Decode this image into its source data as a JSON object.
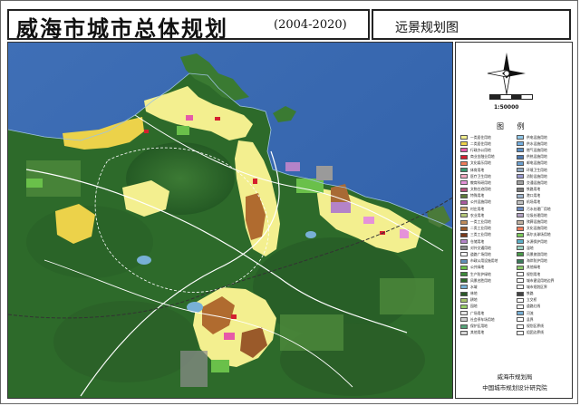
{
  "header": {
    "title": "威海市城市总体规划",
    "years": "(2004-2020)",
    "subtitle": "远景规划图"
  },
  "scale": "1:50000",
  "legend": {
    "title": "图 例",
    "left": [
      {
        "label": "一类居住用地",
        "color": "#f3ef8f"
      },
      {
        "label": "二类居住用地",
        "color": "#ecd24a"
      },
      {
        "label": "行政办公用地",
        "color": "#e65aa8"
      },
      {
        "label": "商业金融业用地",
        "color": "#d4202f"
      },
      {
        "label": "文化娱乐用地",
        "color": "#ef7b5a"
      },
      {
        "label": "体育用地",
        "color": "#3a9a6f"
      },
      {
        "label": "医疗卫生用地",
        "color": "#f2a8bf"
      },
      {
        "label": "教育科研用地",
        "color": "#e592d9"
      },
      {
        "label": "文物古迹用地",
        "color": "#b6527e"
      },
      {
        "label": "特殊用地",
        "color": "#5e7a3a"
      },
      {
        "label": "公共设施用地",
        "color": "#a95aa0"
      },
      {
        "label": "村庄用地",
        "color": "#c8a06a"
      },
      {
        "label": "农业用地",
        "color": "#b5c879"
      },
      {
        "label": "一类工业用地",
        "color": "#bf8b5a"
      },
      {
        "label": "二类工业用地",
        "color": "#9a5a2a"
      },
      {
        "label": "三类工业用地",
        "color": "#7a3a1a"
      },
      {
        "label": "仓储用地",
        "color": "#b483c8"
      },
      {
        "label": "对外交通用地",
        "color": "#8a8a8a"
      },
      {
        "label": "道路广场用地",
        "color": "#ffffff"
      },
      {
        "label": "市政公用设施用地",
        "color": "#5f8fb7"
      },
      {
        "label": "公共绿地",
        "color": "#6ac04a"
      },
      {
        "label": "生产防护绿地",
        "color": "#3d8a3a"
      },
      {
        "label": "风景名胜用地",
        "color": "#2e6a2a"
      },
      {
        "label": "水域",
        "color": "#78b0d6"
      },
      {
        "label": "林地",
        "color": "#2a5a28"
      },
      {
        "label": "耕地",
        "color": "#a8c46a"
      },
      {
        "label": "园地",
        "color": "#9ad06a"
      },
      {
        "label": "广场用地",
        "color": "#e6e6e6"
      },
      {
        "label": "社会停车场用地",
        "color": "#cfcfcf"
      },
      {
        "label": "保护区用地",
        "color": "#57a37a"
      },
      {
        "label": "其他用地",
        "color": "#d7d7d7"
      }
    ],
    "right": [
      {
        "label": "供电设施用地",
        "color": "#8fc7e8"
      },
      {
        "label": "供水设施用地",
        "color": "#73aee0"
      },
      {
        "label": "燃气设施用地",
        "color": "#5b8fc5"
      },
      {
        "label": "供热设施用地",
        "color": "#4f7ab0"
      },
      {
        "label": "邮电设施用地",
        "color": "#6aa0d0"
      },
      {
        "label": "环境卫生用地",
        "color": "#90a8c0"
      },
      {
        "label": "消防设施用地",
        "color": "#9a9ad0"
      },
      {
        "label": "交通设施用地",
        "color": "#a0a0a0"
      },
      {
        "label": "铁路用地",
        "color": "#7a7a7a"
      },
      {
        "label": "港口用地",
        "color": "#9eb4cc"
      },
      {
        "label": "机场用地",
        "color": "#c0c0c0"
      },
      {
        "label": "污水处理厂用地",
        "color": "#6a8ac0"
      },
      {
        "label": "垃圾处理用地",
        "color": "#b0a0c0"
      },
      {
        "label": "殡葬设施用地",
        "color": "#c0b0a0"
      },
      {
        "label": "文化设施用地",
        "color": "#ef7b5a"
      },
      {
        "label": "高尔夫球场用地",
        "color": "#7ac85a"
      },
      {
        "label": "水源保护用地",
        "color": "#5ab0c8"
      },
      {
        "label": "湿地",
        "color": "#9ad0c0"
      },
      {
        "label": "风景旅游用地",
        "color": "#4a9a4a"
      },
      {
        "label": "海岸防护用地",
        "color": "#3a7a5a"
      },
      {
        "label": "其他绿地",
        "color": "#8ac86a"
      },
      {
        "label": "规划用地",
        "color": "#ffffff"
      },
      {
        "label": "城市建设用地边界",
        "color": "#ffffff"
      },
      {
        "label": "城市规划区界",
        "color": "#ffffff"
      },
      {
        "label": "铁路",
        "color": "#444444"
      },
      {
        "label": "立交桥",
        "color": "#ffffff"
      },
      {
        "label": "道路红线",
        "color": "#ffffff"
      },
      {
        "label": "河流",
        "color": "#78b0d6"
      },
      {
        "label": "县界",
        "color": "#ffffff"
      },
      {
        "label": "规划区界线",
        "color": "#ffffff"
      },
      {
        "label": "组团边界线",
        "color": "#ffffff"
      }
    ]
  },
  "org": {
    "line1": "威海市规划局",
    "line2": "中国城市规划设计研究院"
  },
  "colors": {
    "sea": "#3f6fb6",
    "forest": "#2d6a2a",
    "residential": "#f3ef8f",
    "industrial": "#b06b2f",
    "commercial": "#d4202f"
  }
}
